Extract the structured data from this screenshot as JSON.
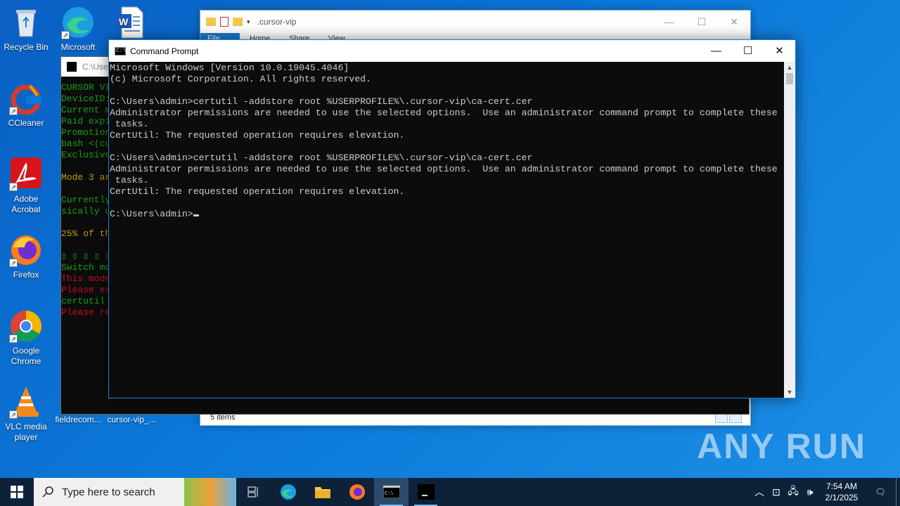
{
  "desktop": {
    "icons": [
      {
        "label": "Recycle Bin",
        "icon": "recycle-bin-icon"
      },
      {
        "label": "Microsoft Edge",
        "icon": "edge-icon"
      },
      {
        "label": "",
        "icon": "word-document-icon"
      },
      {
        "label": "CCleaner",
        "icon": "ccleaner-icon"
      },
      {
        "label": "Adobe Acrobat",
        "icon": "acrobat-icon"
      },
      {
        "label": "Firefox",
        "icon": "firefox-icon"
      },
      {
        "label": "Google Chrome",
        "icon": "chrome-icon"
      },
      {
        "label": "VLC media player",
        "icon": "vlc-icon"
      },
      {
        "label": "fieldrecom...",
        "icon": "file-icon"
      },
      {
        "label": "cursor-vip_...",
        "icon": "exe-icon"
      }
    ]
  },
  "explorer": {
    "title": ".cursor-vip",
    "ribbon_tabs": [
      "File",
      "Home",
      "Share",
      "View"
    ],
    "status": "5 items"
  },
  "bg_cmd": {
    "title": "C:\\User",
    "lines": [
      {
        "text": "CURSOR VI",
        "color": "#13a10e"
      },
      {
        "text": "DeviceID:",
        "color": "#13a10e"
      },
      {
        "text": "Current m",
        "color": "#13a10e"
      },
      {
        "text": "Paid expi",
        "color": "#13a10e"
      },
      {
        "text": "Promotion",
        "color": "#13a10e"
      },
      {
        "text": "bash <(cu",
        "color": "#13a10e"
      },
      {
        "text": "Exclusive",
        "color": "#13a10e"
      },
      {
        "text": "",
        "color": "#13a10e"
      },
      {
        "text": "Mode 3 ar",
        "color": "#c19c00"
      },
      {
        "text": "",
        "color": "#13a10e"
      },
      {
        "text": "Currently",
        "color": "#13a10e"
      },
      {
        "text": "sically u",
        "color": "#13a10e"
      },
      {
        "text": "",
        "color": "#13a10e"
      },
      {
        "text": "25% of th",
        "color": "#c19c00"
      },
      {
        "text": "",
        "color": "#13a10e"
      },
      {
        "text": "▯ ▯ ▯ ▯ ▯",
        "color": "#13a10e"
      },
      {
        "text": "Switch mo",
        "color": "#13a10e"
      },
      {
        "text": "This mode",
        "color": "#c50f1f"
      },
      {
        "text": "Please ex",
        "color": "#c50f1f"
      },
      {
        "text": "certutil ",
        "color": "#13a10e"
      },
      {
        "text": "Please re",
        "color": "#c50f1f"
      }
    ]
  },
  "cmd": {
    "title": "Command Prompt",
    "lines": [
      "Microsoft Windows [Version 10.0.19045.4046]",
      "(c) Microsoft Corporation. All rights reserved.",
      "",
      "C:\\Users\\admin>certutil -addstore root %USERPROFILE%\\.cursor-vip\\ca-cert.cer",
      "Administrator permissions are needed to use the selected options.  Use an administrator command prompt to complete these",
      " tasks.",
      "CertUtil: The requested operation requires elevation.",
      "",
      "C:\\Users\\admin>certutil -addstore root %USERPROFILE%\\.cursor-vip\\ca-cert.cer",
      "Administrator permissions are needed to use the selected options.  Use an administrator command prompt to complete these",
      " tasks.",
      "CertUtil: The requested operation requires elevation.",
      ""
    ],
    "prompt": "C:\\Users\\admin>"
  },
  "taskbar": {
    "search_placeholder": "Type here to search",
    "time": "7:54 AM",
    "date": "2/1/2025"
  },
  "watermark": "ANY RUN"
}
